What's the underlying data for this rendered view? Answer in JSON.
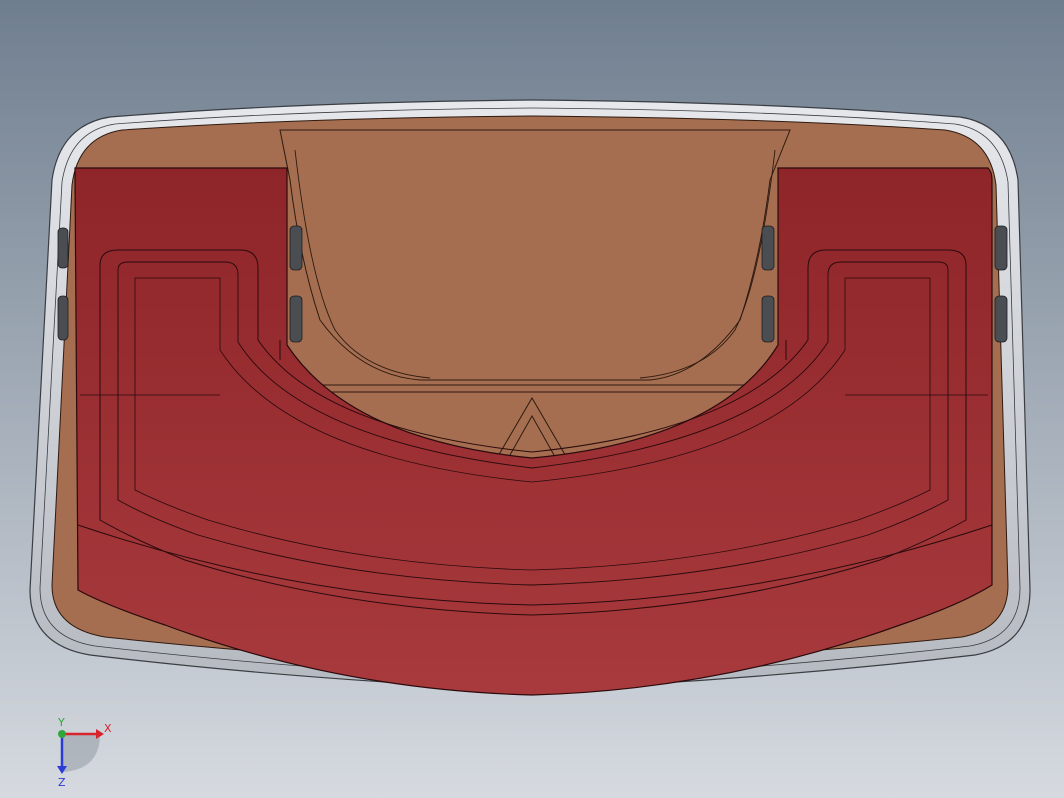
{
  "viewport": {
    "background_top": "#6f7e8f",
    "background_bottom": "#d6dae0"
  },
  "model": {
    "housing_color": "#a56e50",
    "housing_dark": "#7a4a33",
    "body_color": "#8e2529",
    "body_dark": "#6d1a1e",
    "body_light": "#a83a3d",
    "rim_color": "#c9ccd2",
    "fastener_color": "#4a4d52"
  },
  "triad": {
    "x_label": "X",
    "y_label": "Y",
    "z_label": "Z",
    "x_color": "#d8232a",
    "y_color": "#2fa63a",
    "z_color": "#2b3bd6"
  }
}
